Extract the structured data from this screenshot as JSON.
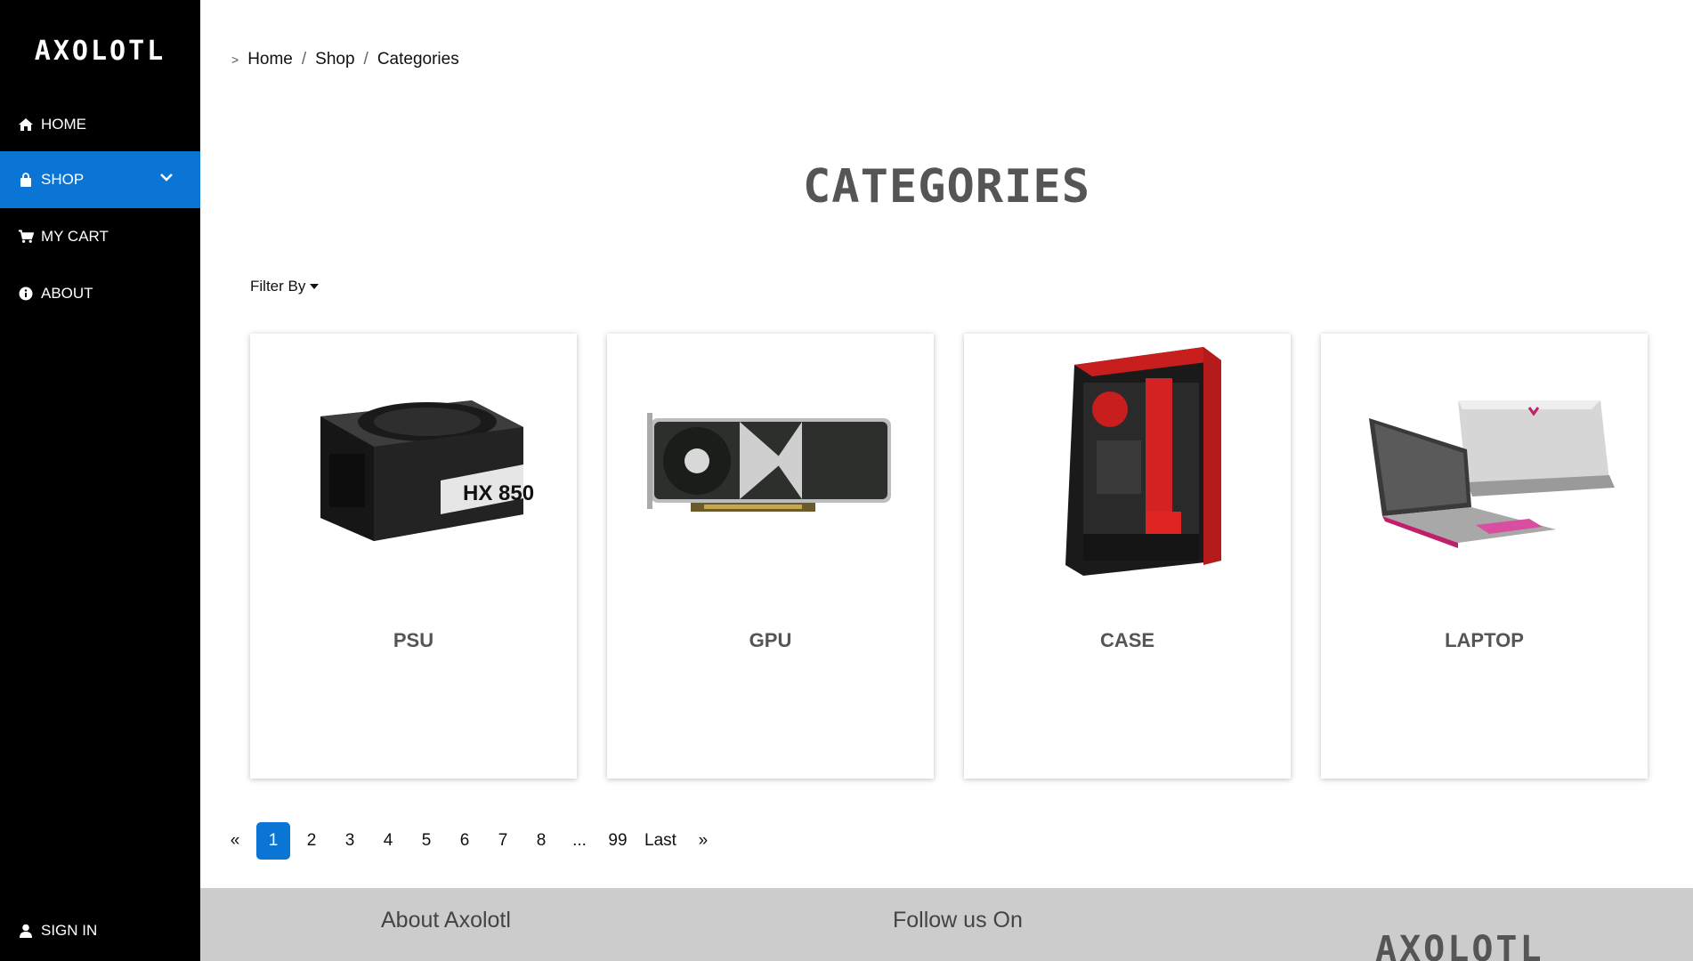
{
  "brand": {
    "name": "AXOLOTL"
  },
  "sidebar": {
    "items": [
      {
        "label": "HOME",
        "icon": "home-icon"
      },
      {
        "label": "SHOP",
        "icon": "shopping-bag-icon",
        "active": true
      },
      {
        "label": "MY CART",
        "icon": "cart-icon"
      },
      {
        "label": "ABOUT",
        "icon": "info-icon"
      }
    ],
    "signin": {
      "label": "SIGN IN",
      "icon": "user-icon"
    }
  },
  "breadcrumb": {
    "items": [
      "Home",
      "Shop",
      "Categories"
    ]
  },
  "page": {
    "title": "CATEGORIES"
  },
  "filter": {
    "label": "Filter By"
  },
  "categories": [
    {
      "name": "PSU",
      "image": "psu-image",
      "img_text": "HX 850"
    },
    {
      "name": "GPU",
      "image": "gpu-image"
    },
    {
      "name": "CASE",
      "image": "case-image"
    },
    {
      "name": "LAPTOP",
      "image": "laptop-image"
    }
  ],
  "pagination": {
    "prev": "«",
    "pages": [
      "1",
      "2",
      "3",
      "4",
      "5",
      "6",
      "7",
      "8",
      "...",
      "99"
    ],
    "current": "1",
    "last": "Last",
    "next": "»"
  },
  "footer": {
    "about": "About Axolotl",
    "follow": "Follow us On",
    "logo": "AXOLOTL"
  },
  "colors": {
    "accent": "#0b75d6",
    "sidebar": "#000000",
    "footer": "#cccccc"
  }
}
